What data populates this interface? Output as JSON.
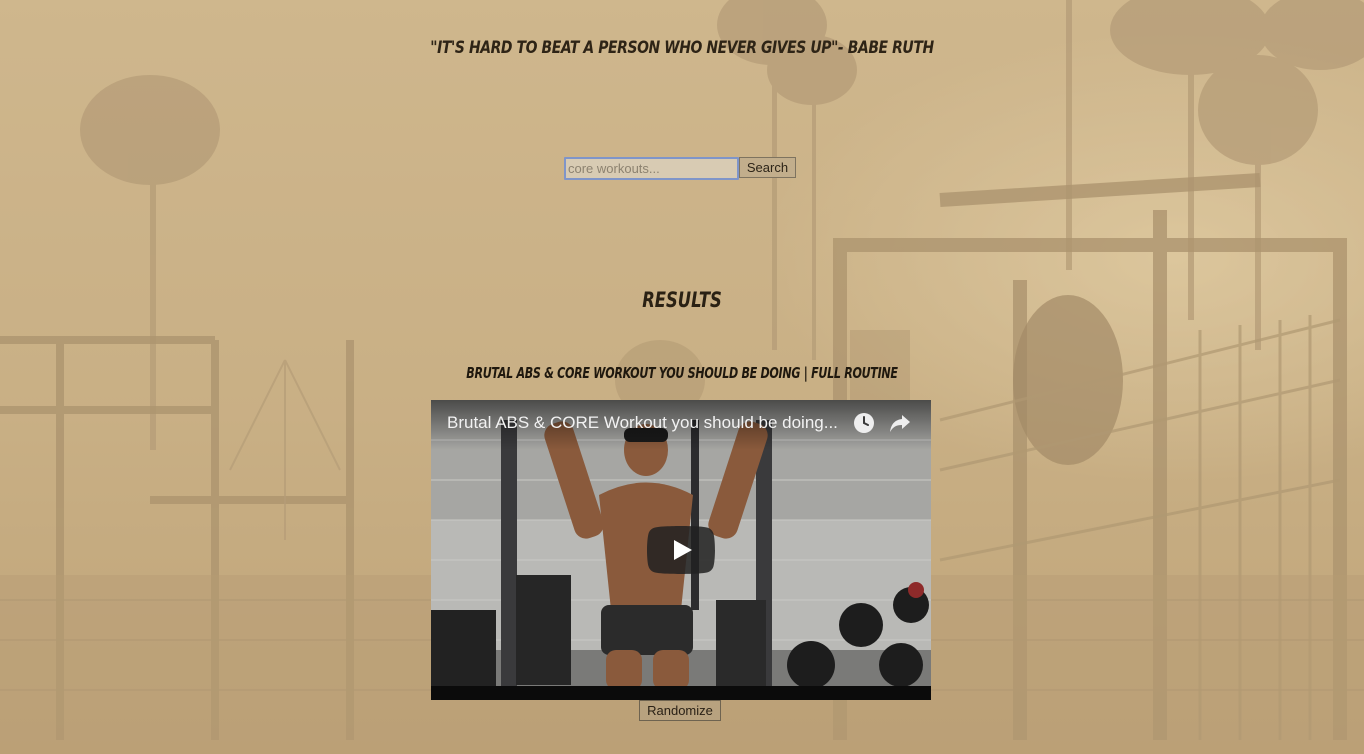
{
  "header": {
    "quote": "\"It's hard to beat a person who never gives up\"- Babe Ruth"
  },
  "search": {
    "value": "",
    "placeholder": "core workouts...",
    "button_label": "Search"
  },
  "results": {
    "heading": "Results",
    "video_title": "Brutal ABS & CORE Workout you should be doing | FULL ROUTINE",
    "player": {
      "title": "Brutal ABS & CORE Workout you should be doing...",
      "watch_later_icon": "clock-icon",
      "share_icon": "share-arrow-icon",
      "play_icon": "play-icon"
    }
  },
  "controls": {
    "randomize_label": "Randomize"
  },
  "colors": {
    "page_background": "#c8b08a",
    "text_dark": "#2a2114",
    "input_focus_border": "#7f95c9"
  }
}
